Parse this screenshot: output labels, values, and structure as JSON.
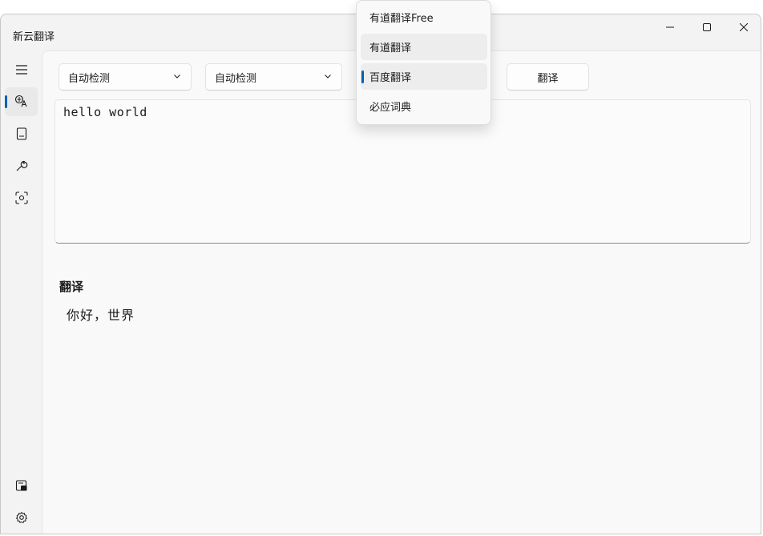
{
  "app": {
    "title": "新云翻译"
  },
  "window_controls": {
    "minimize_icon": "minimize-icon",
    "maximize_icon": "maximize-icon",
    "close_icon": "close-icon"
  },
  "sidebar": {
    "items": [
      {
        "icon": "hamburger-menu-icon"
      },
      {
        "icon": "translate-icon",
        "active": true
      },
      {
        "icon": "book-icon"
      },
      {
        "icon": "wrench-icon"
      },
      {
        "icon": "screenshot-ocr-icon"
      },
      {
        "icon": "clipboard-icon"
      },
      {
        "icon": "gear-icon"
      }
    ]
  },
  "toolbar": {
    "source_lang": "自动检测",
    "target_lang": "自动检测",
    "translate_button": "翻译"
  },
  "input": {
    "text": "hello world"
  },
  "result": {
    "label": "翻译",
    "text": "你好，世界"
  },
  "engine_menu": {
    "items": [
      {
        "label": "有道翻译Free"
      },
      {
        "label": "有道翻译"
      },
      {
        "label": "百度翻译",
        "selected": true
      },
      {
        "label": "必应词典"
      }
    ]
  },
  "colors": {
    "accent": "#005fb8"
  }
}
